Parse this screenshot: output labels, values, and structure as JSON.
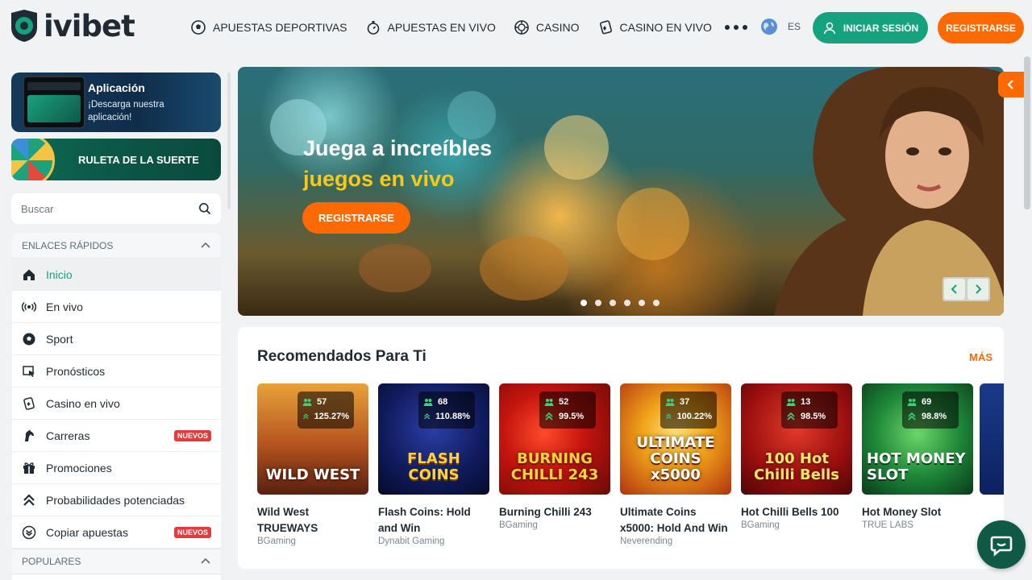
{
  "header": {
    "logo_text": "ivibet",
    "nav": [
      {
        "label": "APUESTAS DEPORTIVAS",
        "icon": "soccer-ball-icon"
      },
      {
        "label": "APUESTAS EN VIVO",
        "icon": "stopwatch-icon"
      },
      {
        "label": "CASINO",
        "icon": "chip-icon"
      },
      {
        "label": "CASINO EN VIVO",
        "icon": "live-casino-icon"
      }
    ],
    "language": "ES",
    "login_label": "INICIAR SESIÓN",
    "register_label": "REGISTRARSE"
  },
  "sidebar": {
    "app_promo": {
      "title": "Aplicación",
      "subtitle": "¡Descarga nuestra aplicación!"
    },
    "wheel_promo": {
      "title": "RULETA DE LA SUERTE"
    },
    "search": {
      "placeholder": "Buscar"
    },
    "quick_links_title": "ENLACES RÁPIDOS",
    "links": [
      {
        "label": "Inicio",
        "icon": "home-icon",
        "active": true
      },
      {
        "label": "En vivo",
        "icon": "broadcast-icon"
      },
      {
        "label": "Sport",
        "icon": "soccer-ball-icon"
      },
      {
        "label": "Pronósticos",
        "icon": "cursor-icon"
      },
      {
        "label": "Casino en vivo",
        "icon": "live-casino-icon"
      },
      {
        "label": "Carreras",
        "icon": "horse-icon",
        "badge": "NUEVOS"
      },
      {
        "label": "Promociones",
        "icon": "gift-icon"
      },
      {
        "label": "Probabilidades potenciadas",
        "icon": "boost-icon"
      },
      {
        "label": "Copiar apuestas",
        "icon": "copy-bet-icon",
        "badge": "NUEVOS"
      }
    ],
    "popular_title": "POPULARES"
  },
  "hero": {
    "line1": "Juega a increíbles",
    "line2": "juegos en vivo",
    "cta": "REGISTRARSE",
    "slides": 6,
    "active_slide": 1
  },
  "recommended": {
    "title": "Recomendados Para Ti",
    "more": "MÁS",
    "games": [
      {
        "name": "Wild West TRUEWAYS",
        "provider": "BGaming",
        "players": "57",
        "rtp": "125.27%",
        "art": "WILD WEST"
      },
      {
        "name": "Flash Coins: Hold and Win",
        "provider": "Dynabit Gaming",
        "players": "68",
        "rtp": "110.88%",
        "art": "FLASH COINS"
      },
      {
        "name": "Burning Chilli 243",
        "provider": "BGaming",
        "players": "52",
        "rtp": "99.5%",
        "art": "BURNING CHILLI 243"
      },
      {
        "name": "Ultimate Coins x5000: Hold And Win",
        "provider": "Neverending",
        "players": "37",
        "rtp": "100.22%",
        "art": "ULTIMATE COINS x5000"
      },
      {
        "name": "Hot Chilli Bells 100",
        "provider": "BGaming",
        "players": "13",
        "rtp": "98.5%",
        "art": "100 Hot Chilli Bells"
      },
      {
        "name": "Hot Money Slot",
        "provider": "TRUE LABS",
        "players": "69",
        "rtp": "98.8%",
        "art": "HOT MONEY SLOT"
      }
    ]
  },
  "colors": {
    "accent": "#15a37f",
    "brand_orange": "#ff6a00",
    "text": "#1f2a33"
  }
}
